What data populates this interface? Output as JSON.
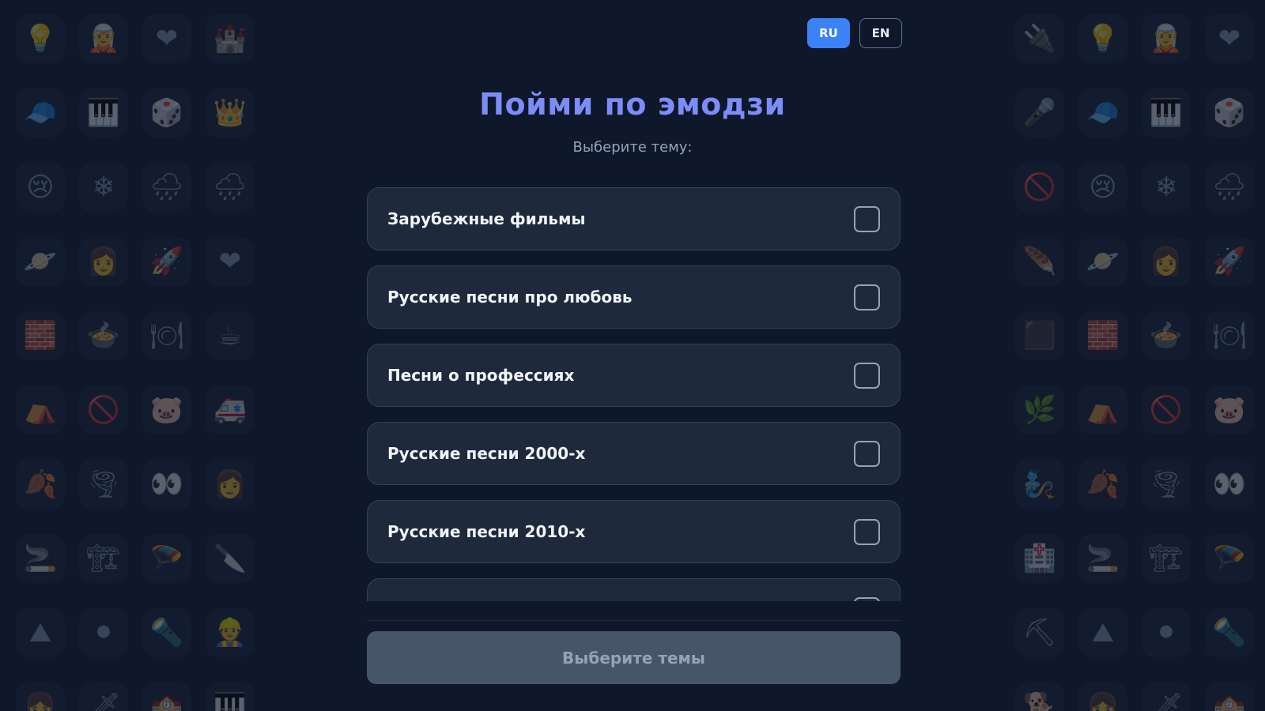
{
  "language": {
    "options": [
      {
        "label": "RU",
        "active": true
      },
      {
        "label": "EN",
        "active": false
      }
    ]
  },
  "title": "Пойми по эмодзи",
  "subtitle": "Выберите тему:",
  "topics": [
    {
      "label": "Зарубежные фильмы",
      "checked": false
    },
    {
      "label": "Русские песни про любовь",
      "checked": false
    },
    {
      "label": "Песни о профессиях",
      "checked": false
    },
    {
      "label": "Русские песни 2000-х",
      "checked": false
    },
    {
      "label": "Русские песни 2010-х",
      "checked": false
    }
  ],
  "submit_label": "Выберите темы",
  "colors": {
    "background": "#0f172a",
    "accent": "#3b82f6",
    "title": "#7c8cf8",
    "card": "#1e293b",
    "disabled_button": "#475569"
  },
  "decor_left": [
    "💡",
    "🧝",
    "❤",
    "🏰",
    "🧢",
    "🎹",
    "🎲",
    "👑",
    "😢",
    "❄",
    "🌧",
    "🌧",
    "🪐",
    "👩",
    "🚀",
    "❤",
    "🧱",
    "🍲",
    "🍽",
    "☕",
    "⛺",
    "🚫",
    "🐷",
    "🚑",
    "🍂",
    "🌪",
    "👀",
    "👩",
    "🚬",
    "🏗",
    "🪂",
    "🔪",
    "⛰",
    "⚫",
    "🔦",
    "👷",
    "👧",
    "🗡",
    "🏫",
    "🎹"
  ],
  "decor_right": [
    "🔌",
    "💡",
    "🧝",
    "❤",
    "🎤",
    "🧢",
    "🎹",
    "🎲",
    "🚫",
    "😢",
    "❄",
    "🌧",
    "🪶",
    "🪐",
    "👩",
    "🚀",
    "⬛",
    "🧱",
    "🍲",
    "🍽",
    "🌿",
    "⛺",
    "🚫",
    "🐷",
    "🧞",
    "🍂",
    "🌪",
    "👀",
    "🏥",
    "🚬",
    "🏗",
    "🪂",
    "⛏",
    "⛰",
    "⚫",
    "🔦",
    "🐕",
    "👧",
    "🗡",
    "🏫"
  ]
}
